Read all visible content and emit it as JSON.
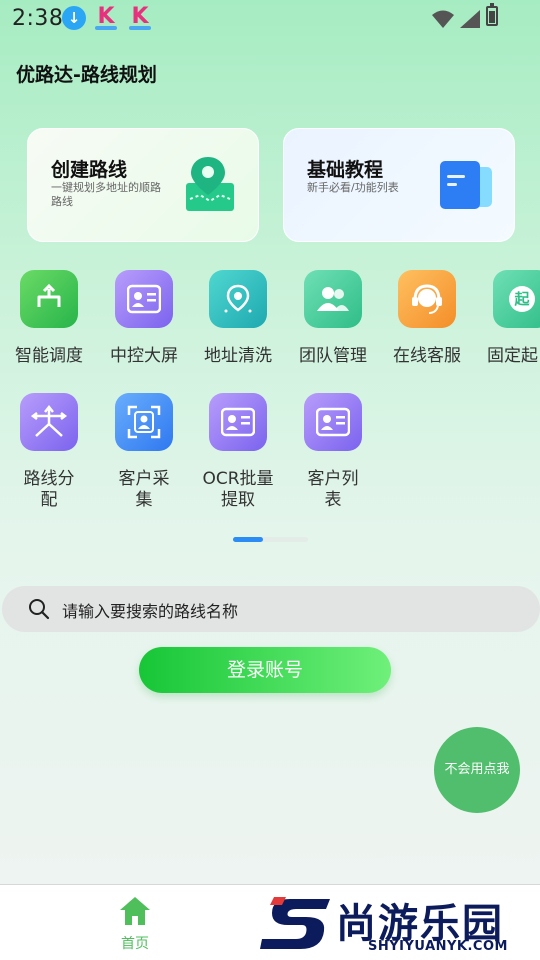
{
  "status_bar": {
    "time": "2:38"
  },
  "header": {
    "title": "优路达-路线规划"
  },
  "cards": [
    {
      "title": "创建路线",
      "subtitle": "一键规划多地址的顺路路线"
    },
    {
      "title": "基础教程",
      "subtitle": "新手必看/功能列表"
    }
  ],
  "features": [
    {
      "label": "智能调度",
      "icon": "route-split-icon"
    },
    {
      "label": "中控大屏",
      "icon": "id-card-icon"
    },
    {
      "label": "地址清洗",
      "icon": "location-pin-icon"
    },
    {
      "label": "团队管理",
      "icon": "team-icon"
    },
    {
      "label": "在线客服",
      "icon": "headset-icon"
    },
    {
      "label": "固定起",
      "icon_text": "起",
      "icon": "fixed-start-icon"
    },
    {
      "label": "路线分\n配",
      "icon": "distribute-arrows-icon"
    },
    {
      "label": "客户采\n集",
      "icon": "scan-person-icon"
    },
    {
      "label": "OCR批量\n提取",
      "icon": "id-card-icon"
    },
    {
      "label": "客户列\n表",
      "icon": "id-card-icon"
    }
  ],
  "search": {
    "placeholder": "请输入要搜索的路线名称"
  },
  "login": {
    "label": "登录账号"
  },
  "help": {
    "label": "不会用点我"
  },
  "bottom_nav": {
    "home_label": "首页"
  },
  "watermark": {
    "cn": "尚游乐园",
    "en": "SHYIYUANYK.COM"
  },
  "colors": {
    "accent_green": "#17c637",
    "pager_active": "#2b8cf6"
  }
}
